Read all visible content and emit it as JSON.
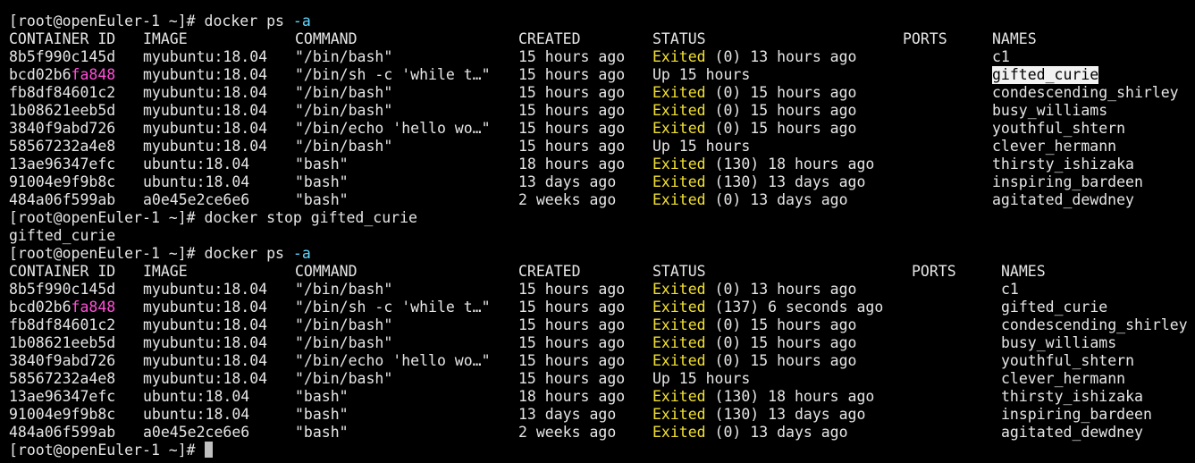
{
  "terminal": {
    "prompt": "[root@openEuler-1 ~]# ",
    "cmd1": {
      "base": "docker ps ",
      "flag": "-a"
    },
    "cmd2": "docker stop gifted_curie",
    "stop_output": "gifted_curie",
    "cmd3": {
      "base": "docker ps ",
      "flag": "-a"
    },
    "headers": {
      "container_id": "CONTAINER ID",
      "image": "IMAGE",
      "command": "COMMAND",
      "created": "CREATED",
      "status": "STATUS",
      "ports": "PORTS",
      "names": "NAMES"
    },
    "table1": [
      {
        "id_a": "8b5f990c145d",
        "id_b": "",
        "image": "myubuntu:18.04",
        "command": "\"/bin/bash\"",
        "created": "15 hours ago",
        "status_word": "Exited",
        "status_rest": " (0) 13 hours ago",
        "name": "c1"
      },
      {
        "id_a": "bcd02b6",
        "id_b": "fa848",
        "image": "myubuntu:18.04",
        "command": "\"/bin/sh -c 'while t…\"",
        "created": "15 hours ago",
        "status_word": "",
        "status_rest": "Up 15 hours",
        "name": "gifted_curie"
      },
      {
        "id_a": "fb8df84601c2",
        "id_b": "",
        "image": "myubuntu:18.04",
        "command": "\"/bin/bash\"",
        "created": "15 hours ago",
        "status_word": "Exited",
        "status_rest": " (0) 15 hours ago",
        "name": "condescending_shirley"
      },
      {
        "id_a": "1b08621eeb5d",
        "id_b": "",
        "image": "myubuntu:18.04",
        "command": "\"/bin/bash\"",
        "created": "15 hours ago",
        "status_word": "Exited",
        "status_rest": " (0) 15 hours ago",
        "name": "busy_williams"
      },
      {
        "id_a": "3840f9abd726",
        "id_b": "",
        "image": "myubuntu:18.04",
        "command": "\"/bin/echo 'hello wo…\"",
        "created": "15 hours ago",
        "status_word": "Exited",
        "status_rest": " (0) 15 hours ago",
        "name": "youthful_shtern"
      },
      {
        "id_a": "58567232a4e8",
        "id_b": "",
        "image": "myubuntu:18.04",
        "command": "\"/bin/bash\"",
        "created": "15 hours ago",
        "status_word": "",
        "status_rest": "Up 15 hours",
        "name": "clever_hermann"
      },
      {
        "id_a": "13ae96347efc",
        "id_b": "",
        "image": "ubuntu:18.04",
        "command": "\"bash\"",
        "created": "18 hours ago",
        "status_word": "Exited",
        "status_rest": " (130) 18 hours ago",
        "name": "thirsty_ishizaka"
      },
      {
        "id_a": "91004e9f9b8c",
        "id_b": "",
        "image": "ubuntu:18.04",
        "command": "\"bash\"",
        "created": "13 days ago",
        "status_word": "Exited",
        "status_rest": " (130) 13 days ago",
        "name": "inspiring_bardeen"
      },
      {
        "id_a": "484a06f599ab",
        "id_b": "",
        "image": "a0e45e2ce6e6",
        "command": "\"bash\"",
        "created": "2 weeks ago",
        "status_word": "Exited",
        "status_rest": " (0) 13 days ago",
        "name": "agitated_dewdney"
      }
    ],
    "table2": [
      {
        "id_a": "8b5f990c145d",
        "id_b": "",
        "image": "myubuntu:18.04",
        "command": "\"/bin/bash\"",
        "created": "15 hours ago",
        "status_word": "Exited",
        "status_rest": " (0) 13 hours ago",
        "name": "c1"
      },
      {
        "id_a": "bcd02b6",
        "id_b": "fa848",
        "image": "myubuntu:18.04",
        "command": "\"/bin/sh -c 'while t…\"",
        "created": "15 hours ago",
        "status_word": "Exited",
        "status_rest": " (137) 6 seconds ago",
        "name": "gifted_curie"
      },
      {
        "id_a": "fb8df84601c2",
        "id_b": "",
        "image": "myubuntu:18.04",
        "command": "\"/bin/bash\"",
        "created": "15 hours ago",
        "status_word": "Exited",
        "status_rest": " (0) 15 hours ago",
        "name": "condescending_shirley"
      },
      {
        "id_a": "1b08621eeb5d",
        "id_b": "",
        "image": "myubuntu:18.04",
        "command": "\"/bin/bash\"",
        "created": "15 hours ago",
        "status_word": "Exited",
        "status_rest": " (0) 15 hours ago",
        "name": "busy_williams"
      },
      {
        "id_a": "3840f9abd726",
        "id_b": "",
        "image": "myubuntu:18.04",
        "command": "\"/bin/echo 'hello wo…\"",
        "created": "15 hours ago",
        "status_word": "Exited",
        "status_rest": " (0) 15 hours ago",
        "name": "youthful_shtern"
      },
      {
        "id_a": "58567232a4e8",
        "id_b": "",
        "image": "myubuntu:18.04",
        "command": "\"/bin/bash\"",
        "created": "15 hours ago",
        "status_word": "",
        "status_rest": "Up 15 hours",
        "name": "clever_hermann"
      },
      {
        "id_a": "13ae96347efc",
        "id_b": "",
        "image": "ubuntu:18.04",
        "command": "\"bash\"",
        "created": "18 hours ago",
        "status_word": "Exited",
        "status_rest": " (130) 18 hours ago",
        "name": "thirsty_ishizaka"
      },
      {
        "id_a": "91004e9f9b8c",
        "id_b": "",
        "image": "ubuntu:18.04",
        "command": "\"bash\"",
        "created": "13 days ago",
        "status_word": "Exited",
        "status_rest": " (130) 13 days ago",
        "name": "inspiring_bardeen"
      },
      {
        "id_a": "484a06f599ab",
        "id_b": "",
        "image": "a0e45e2ce6e6",
        "command": "\"bash\"",
        "created": "2 weeks ago",
        "status_word": "Exited",
        "status_rest": " (0) 13 days ago",
        "name": "agitated_dewdney"
      }
    ],
    "highlighted_name": "gifted_curie",
    "colors": {
      "background": "#000000",
      "foreground": "#e6e6e6",
      "flag": "#5fd7ff",
      "id_highlight": "#ff4fd8",
      "exited": "#f2e033",
      "selection_bg": "#f2f2f2"
    }
  }
}
